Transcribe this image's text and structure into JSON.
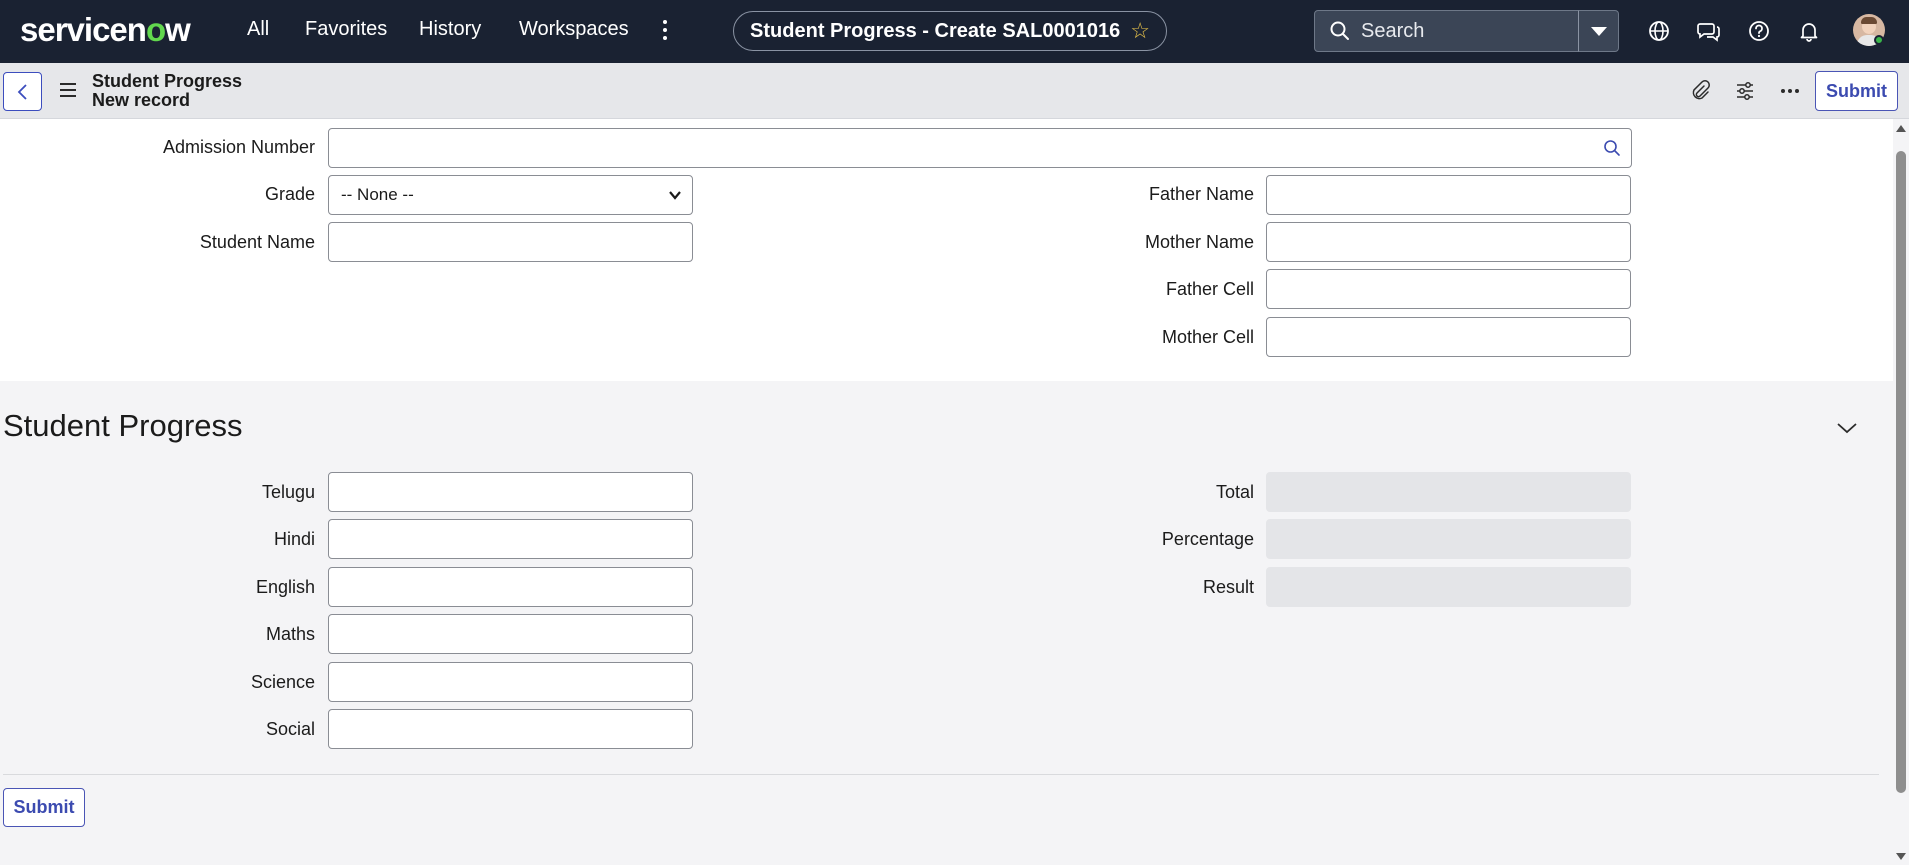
{
  "nav": {
    "brand_pre": "servicen",
    "brand_o": "o",
    "brand_post": "w",
    "links": [
      "All",
      "Favorites",
      "History",
      "Workspaces"
    ],
    "page_title": "Student Progress - Create SAL0001016",
    "search_label": "Search"
  },
  "header": {
    "title": "Student Progress",
    "subtitle": "New record",
    "submit_label": "Submit"
  },
  "form": {
    "admission_number": {
      "label": "Admission Number",
      "value": ""
    },
    "grade": {
      "label": "Grade",
      "value": "-- None --"
    },
    "student_name": {
      "label": "Student Name",
      "value": ""
    },
    "father_name": {
      "label": "Father Name",
      "value": ""
    },
    "mother_name": {
      "label": "Mother Name",
      "value": ""
    },
    "father_cell": {
      "label": "Father Cell",
      "value": ""
    },
    "mother_cell": {
      "label": "Mother Cell",
      "value": ""
    }
  },
  "section": {
    "title": "Student Progress",
    "subjects": [
      {
        "label": "Telugu",
        "value": ""
      },
      {
        "label": "Hindi",
        "value": ""
      },
      {
        "label": "English",
        "value": ""
      },
      {
        "label": "Maths",
        "value": ""
      },
      {
        "label": "Science",
        "value": ""
      },
      {
        "label": "Social",
        "value": ""
      }
    ],
    "results": [
      {
        "label": "Total",
        "value": ""
      },
      {
        "label": "Percentage",
        "value": ""
      },
      {
        "label": "Result",
        "value": ""
      }
    ]
  },
  "footer": {
    "submit_label": "Submit"
  },
  "colors": {
    "nav_bg": "#1a2232",
    "accent": "#3c4bb0",
    "brand_green": "#62d84e",
    "star": "#e6c14a"
  },
  "icons": {
    "nav": [
      "globe-icon",
      "chat-icon",
      "help-icon",
      "bell-icon"
    ],
    "header": [
      "paperclip-icon",
      "sliders-icon",
      "more-icon"
    ]
  }
}
